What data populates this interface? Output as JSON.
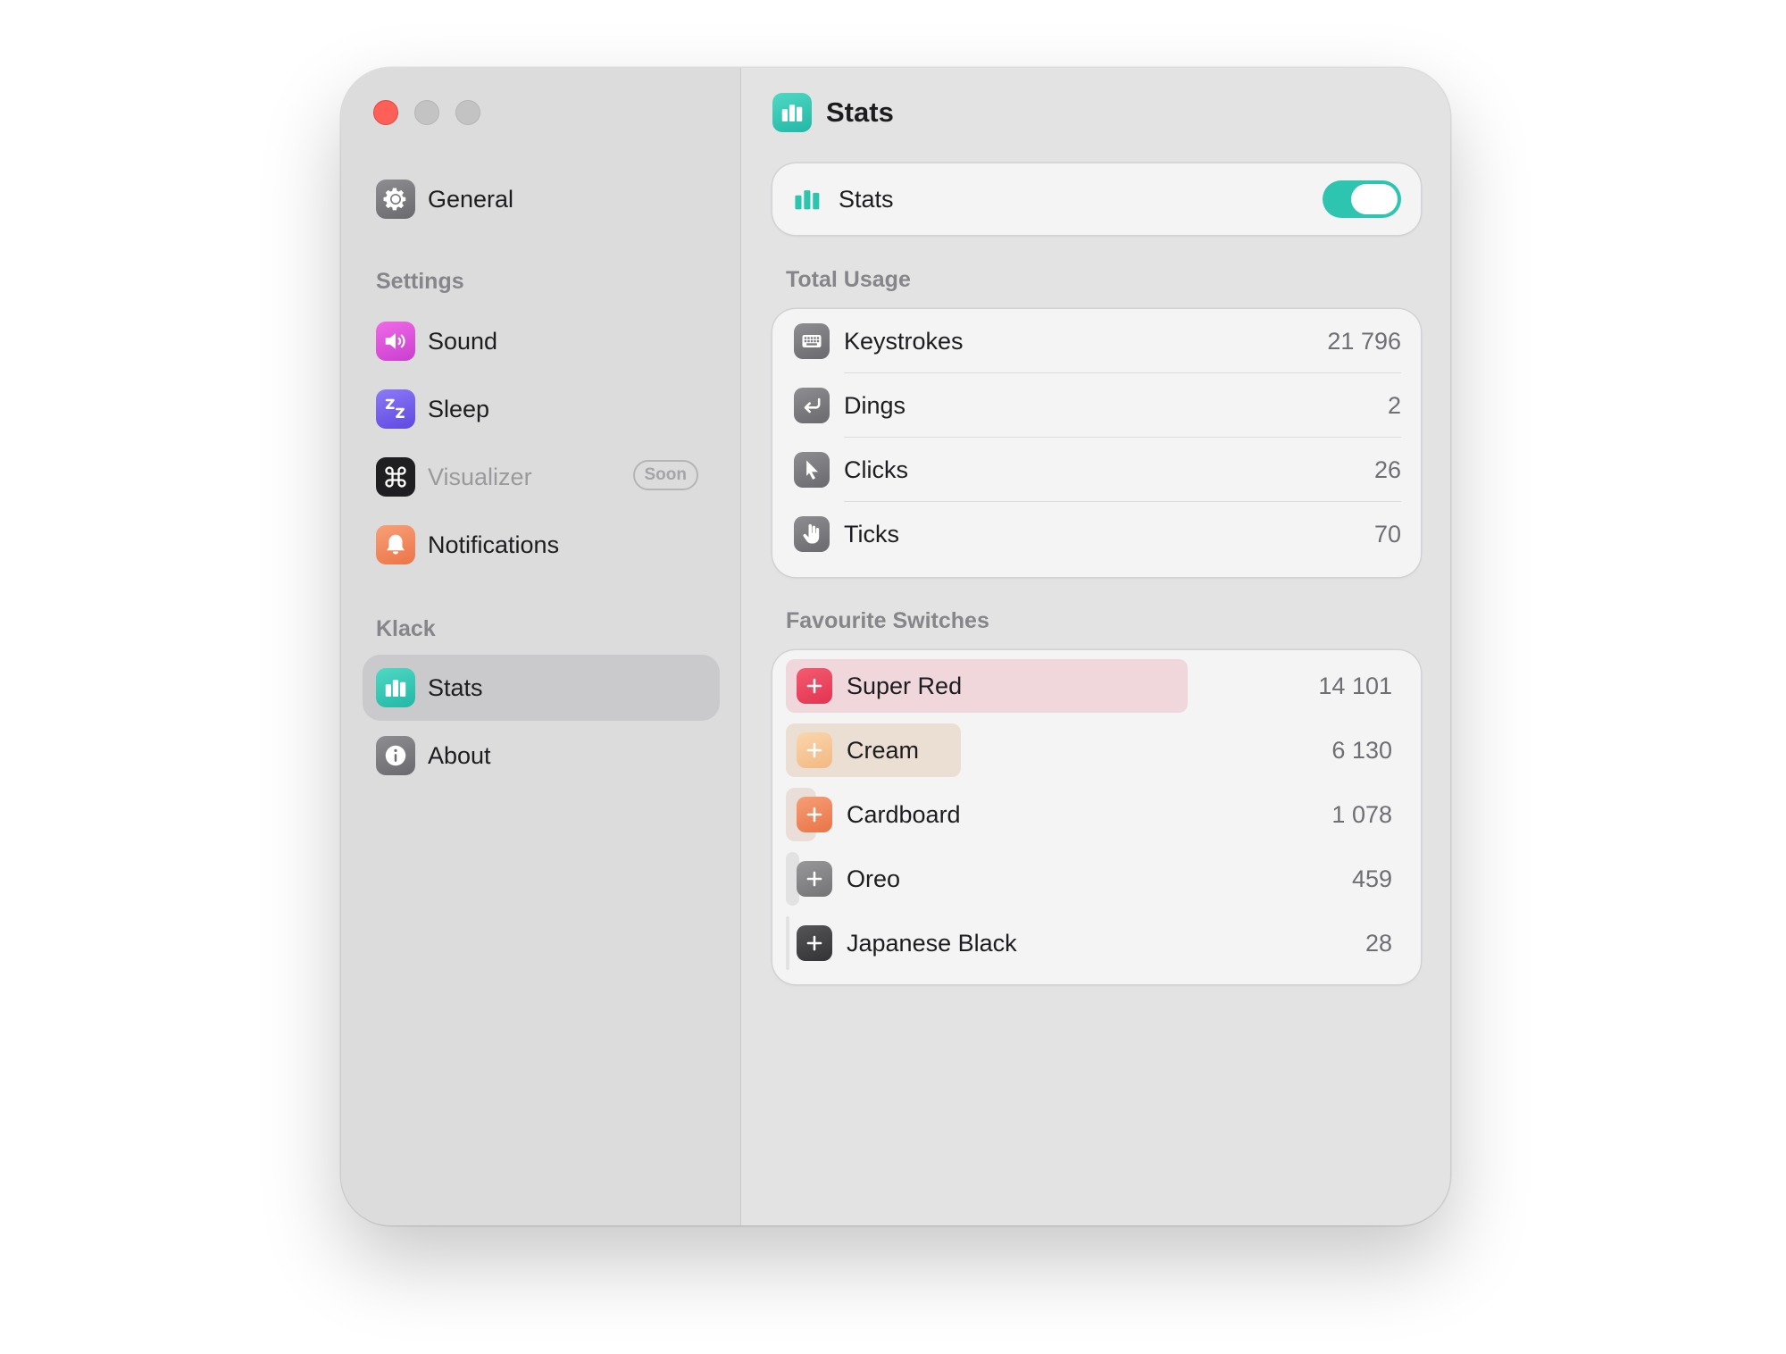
{
  "window_controls": [
    "close",
    "minimize",
    "zoom"
  ],
  "sidebar": {
    "general": {
      "label": "General",
      "icon": "gear-icon"
    },
    "sections": [
      {
        "title": "Settings"
      },
      {
        "title": "Klack"
      }
    ],
    "settings_items": [
      {
        "label": "Sound",
        "icon": "speaker-icon",
        "color": "#e04fd8"
      },
      {
        "label": "Sleep",
        "icon": "sleep-zz-icon",
        "color": "#7b5cf0"
      },
      {
        "label": "Visualizer",
        "icon": "command-icon",
        "color": "#1d1d1f",
        "badge": "Soon",
        "disabled": true
      },
      {
        "label": "Notifications",
        "icon": "bell-icon",
        "color": "#f28a5c"
      }
    ],
    "klack_items": [
      {
        "label": "Stats",
        "icon": "bar-chart-icon",
        "color": "#2ec5b0",
        "selected": true
      },
      {
        "label": "About",
        "icon": "info-icon",
        "color": "#7d7d80"
      }
    ]
  },
  "main": {
    "title": "Stats",
    "toggle": {
      "label": "Stats",
      "enabled": true,
      "accent": "#2ec5b0"
    },
    "total_usage": {
      "title": "Total Usage",
      "rows": [
        {
          "label": "Keystrokes",
          "value": "21 796",
          "icon": "keyboard-icon"
        },
        {
          "label": "Dings",
          "value": "2",
          "icon": "return-arrow-icon"
        },
        {
          "label": "Clicks",
          "value": "26",
          "icon": "cursor-icon"
        },
        {
          "label": "Ticks",
          "value": "70",
          "icon": "hand-icon"
        }
      ]
    },
    "favourite_switches": {
      "title": "Favourite Switches",
      "rows": [
        {
          "label": "Super Red",
          "value": "14 101",
          "count": 14101,
          "share": 1.0,
          "icon": "plus-icon",
          "icon_color": "#f0435c",
          "bar_color": "#f0d7dc"
        },
        {
          "label": "Cream",
          "value": "6 130",
          "count": 6130,
          "share": 0.435,
          "icon": "plus-icon",
          "icon_color": "#f7c89a",
          "bar_color": "#ebdfd3"
        },
        {
          "label": "Cardboard",
          "value": "1 078",
          "count": 1078,
          "share": 0.076,
          "icon": "plus-icon",
          "icon_color": "#ee8a5e",
          "bar_color": "#eadfd8"
        },
        {
          "label": "Oreo",
          "value": "459",
          "count": 459,
          "share": 0.033,
          "icon": "plus-icon",
          "icon_color": "#8a8a8d",
          "bar_color": "#e2e2e3"
        },
        {
          "label": "Japanese Black",
          "value": "28",
          "count": 28,
          "share": 0.002,
          "icon": "plus-icon",
          "icon_color": "#444446",
          "bar_color": "#e2e2e3"
        }
      ]
    }
  }
}
